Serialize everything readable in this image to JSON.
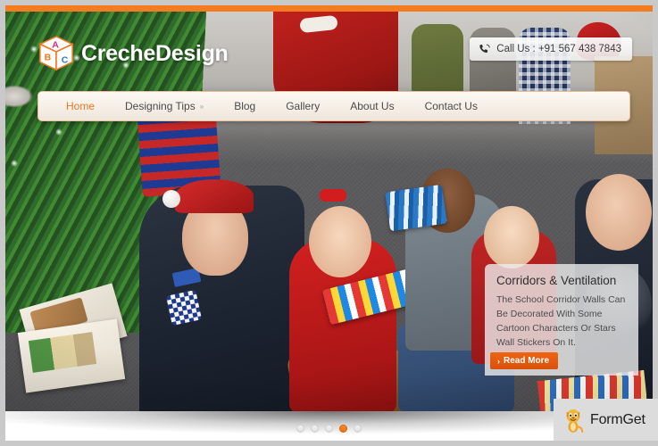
{
  "site": {
    "logo_text": "CrecheDesign",
    "logo_icon": "abc-cube-icon",
    "cube_letters": [
      "A",
      "B",
      "C"
    ]
  },
  "header": {
    "call_us": {
      "icon": "phone-icon",
      "text": "Call Us : +91 567 438 7843"
    }
  },
  "nav": {
    "items": [
      {
        "label": "Home",
        "active": true,
        "has_dropdown": false
      },
      {
        "label": "Designing Tips",
        "active": false,
        "has_dropdown": true,
        "caret": "»"
      },
      {
        "label": "Blog",
        "active": false,
        "has_dropdown": false
      },
      {
        "label": "Gallery",
        "active": false,
        "has_dropdown": false
      },
      {
        "label": "About Us",
        "active": false,
        "has_dropdown": false
      },
      {
        "label": "Contact Us",
        "active": false,
        "has_dropdown": false
      }
    ]
  },
  "slider": {
    "caption": {
      "title": "Corridors & Ventilation",
      "body": "The School Corridor Walls Can Be Decorated With Some Cartoon Characters Or Stars Wall Stickers On It.",
      "read_more_label": "Read More",
      "read_more_caret": "›"
    },
    "dots": {
      "count": 5,
      "active_index": 3
    }
  },
  "watermark": {
    "label": "FormGet",
    "icon": "cat-mascot-icon"
  },
  "colors": {
    "accent_orange": "#f47c20",
    "button_orange": "#ef6412",
    "active_nav": "#ef7622",
    "nav_text": "#4a4a4a",
    "caption_bg": "rgba(236,236,236,0.80)",
    "page_bg": "#ffffff",
    "outer_bg": "#c9c9c9"
  }
}
